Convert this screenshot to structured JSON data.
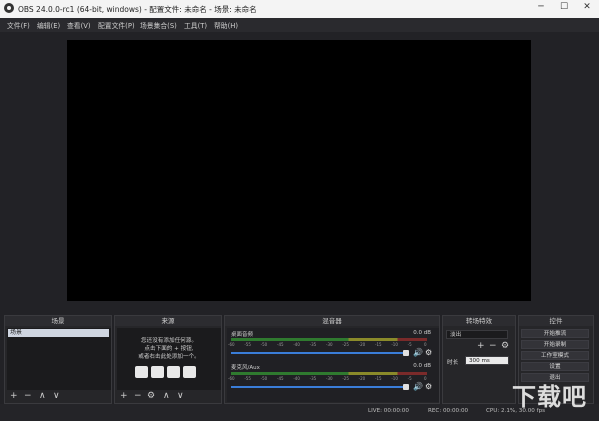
{
  "window": {
    "title": "OBS 24.0.0-rc1 (64-bit, windows) - 配置文件: 未命名 - 场景: 未命名",
    "buttons": {
      "minimize": "─",
      "maximize": "☐",
      "close": "✕"
    }
  },
  "menu": [
    "文件(F)",
    "编辑(E)",
    "查看(V)",
    "配置文件(P)",
    "场景集合(S)",
    "工具(T)",
    "帮助(H)"
  ],
  "docks": {
    "scenes": {
      "title": "场景",
      "items": [
        "场景"
      ]
    },
    "sources": {
      "title": "来源",
      "hint": [
        "您还没有添加任何源。",
        "点击下面的 + 按钮,",
        "或者右击此处添加一个。"
      ]
    },
    "mixer": {
      "title": "混音器",
      "channels": [
        {
          "name": "桌面音频",
          "db": "0.0 dB"
        },
        {
          "name": "麦克风/Aux",
          "db": "0.0 dB"
        }
      ],
      "ticks": [
        "-60",
        "-55",
        "-50",
        "-45",
        "-40",
        "-35",
        "-30",
        "-25",
        "-20",
        "-15",
        "-10",
        "-5",
        "0"
      ]
    },
    "transitions": {
      "title": "转场特效",
      "selected": "淡出",
      "duration_label": "时长",
      "duration_value": "300 ms"
    },
    "controls": {
      "title": "控件",
      "buttons": [
        "开始推流",
        "开始录制",
        "工作室模式",
        "设置",
        "退出"
      ]
    }
  },
  "toolbar_glyphs": {
    "add": "+",
    "remove": "−",
    "up": "∧",
    "down": "∨",
    "gear": "⚙",
    "speaker": "🔊"
  },
  "status": {
    "live": "LIVE: 00:00:00",
    "rec": "REC: 00:00:00",
    "cpu": "CPU: 2.1%, 30.00 fps"
  },
  "watermark": {
    "text": "下载吧"
  }
}
